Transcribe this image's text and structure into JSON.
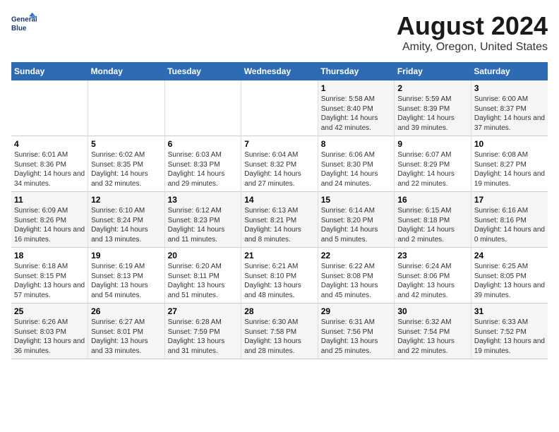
{
  "header": {
    "logo_line1": "General",
    "logo_line2": "Blue",
    "main_title": "August 2024",
    "subtitle": "Amity, Oregon, United States"
  },
  "calendar": {
    "days_of_week": [
      "Sunday",
      "Monday",
      "Tuesday",
      "Wednesday",
      "Thursday",
      "Friday",
      "Saturday"
    ],
    "weeks": [
      [
        {
          "day": "",
          "info": ""
        },
        {
          "day": "",
          "info": ""
        },
        {
          "day": "",
          "info": ""
        },
        {
          "day": "",
          "info": ""
        },
        {
          "day": "1",
          "info": "Sunrise: 5:58 AM\nSunset: 8:40 PM\nDaylight: 14 hours and 42 minutes."
        },
        {
          "day": "2",
          "info": "Sunrise: 5:59 AM\nSunset: 8:39 PM\nDaylight: 14 hours and 39 minutes."
        },
        {
          "day": "3",
          "info": "Sunrise: 6:00 AM\nSunset: 8:37 PM\nDaylight: 14 hours and 37 minutes."
        }
      ],
      [
        {
          "day": "4",
          "info": "Sunrise: 6:01 AM\nSunset: 8:36 PM\nDaylight: 14 hours and 34 minutes."
        },
        {
          "day": "5",
          "info": "Sunrise: 6:02 AM\nSunset: 8:35 PM\nDaylight: 14 hours and 32 minutes."
        },
        {
          "day": "6",
          "info": "Sunrise: 6:03 AM\nSunset: 8:33 PM\nDaylight: 14 hours and 29 minutes."
        },
        {
          "day": "7",
          "info": "Sunrise: 6:04 AM\nSunset: 8:32 PM\nDaylight: 14 hours and 27 minutes."
        },
        {
          "day": "8",
          "info": "Sunrise: 6:06 AM\nSunset: 8:30 PM\nDaylight: 14 hours and 24 minutes."
        },
        {
          "day": "9",
          "info": "Sunrise: 6:07 AM\nSunset: 8:29 PM\nDaylight: 14 hours and 22 minutes."
        },
        {
          "day": "10",
          "info": "Sunrise: 6:08 AM\nSunset: 8:27 PM\nDaylight: 14 hours and 19 minutes."
        }
      ],
      [
        {
          "day": "11",
          "info": "Sunrise: 6:09 AM\nSunset: 8:26 PM\nDaylight: 14 hours and 16 minutes."
        },
        {
          "day": "12",
          "info": "Sunrise: 6:10 AM\nSunset: 8:24 PM\nDaylight: 14 hours and 13 minutes."
        },
        {
          "day": "13",
          "info": "Sunrise: 6:12 AM\nSunset: 8:23 PM\nDaylight: 14 hours and 11 minutes."
        },
        {
          "day": "14",
          "info": "Sunrise: 6:13 AM\nSunset: 8:21 PM\nDaylight: 14 hours and 8 minutes."
        },
        {
          "day": "15",
          "info": "Sunrise: 6:14 AM\nSunset: 8:20 PM\nDaylight: 14 hours and 5 minutes."
        },
        {
          "day": "16",
          "info": "Sunrise: 6:15 AM\nSunset: 8:18 PM\nDaylight: 14 hours and 2 minutes."
        },
        {
          "day": "17",
          "info": "Sunrise: 6:16 AM\nSunset: 8:16 PM\nDaylight: 14 hours and 0 minutes."
        }
      ],
      [
        {
          "day": "18",
          "info": "Sunrise: 6:18 AM\nSunset: 8:15 PM\nDaylight: 13 hours and 57 minutes."
        },
        {
          "day": "19",
          "info": "Sunrise: 6:19 AM\nSunset: 8:13 PM\nDaylight: 13 hours and 54 minutes."
        },
        {
          "day": "20",
          "info": "Sunrise: 6:20 AM\nSunset: 8:11 PM\nDaylight: 13 hours and 51 minutes."
        },
        {
          "day": "21",
          "info": "Sunrise: 6:21 AM\nSunset: 8:10 PM\nDaylight: 13 hours and 48 minutes."
        },
        {
          "day": "22",
          "info": "Sunrise: 6:22 AM\nSunset: 8:08 PM\nDaylight: 13 hours and 45 minutes."
        },
        {
          "day": "23",
          "info": "Sunrise: 6:24 AM\nSunset: 8:06 PM\nDaylight: 13 hours and 42 minutes."
        },
        {
          "day": "24",
          "info": "Sunrise: 6:25 AM\nSunset: 8:05 PM\nDaylight: 13 hours and 39 minutes."
        }
      ],
      [
        {
          "day": "25",
          "info": "Sunrise: 6:26 AM\nSunset: 8:03 PM\nDaylight: 13 hours and 36 minutes."
        },
        {
          "day": "26",
          "info": "Sunrise: 6:27 AM\nSunset: 8:01 PM\nDaylight: 13 hours and 33 minutes."
        },
        {
          "day": "27",
          "info": "Sunrise: 6:28 AM\nSunset: 7:59 PM\nDaylight: 13 hours and 31 minutes."
        },
        {
          "day": "28",
          "info": "Sunrise: 6:30 AM\nSunset: 7:58 PM\nDaylight: 13 hours and 28 minutes."
        },
        {
          "day": "29",
          "info": "Sunrise: 6:31 AM\nSunset: 7:56 PM\nDaylight: 13 hours and 25 minutes."
        },
        {
          "day": "30",
          "info": "Sunrise: 6:32 AM\nSunset: 7:54 PM\nDaylight: 13 hours and 22 minutes."
        },
        {
          "day": "31",
          "info": "Sunrise: 6:33 AM\nSunset: 7:52 PM\nDaylight: 13 hours and 19 minutes."
        }
      ]
    ]
  }
}
